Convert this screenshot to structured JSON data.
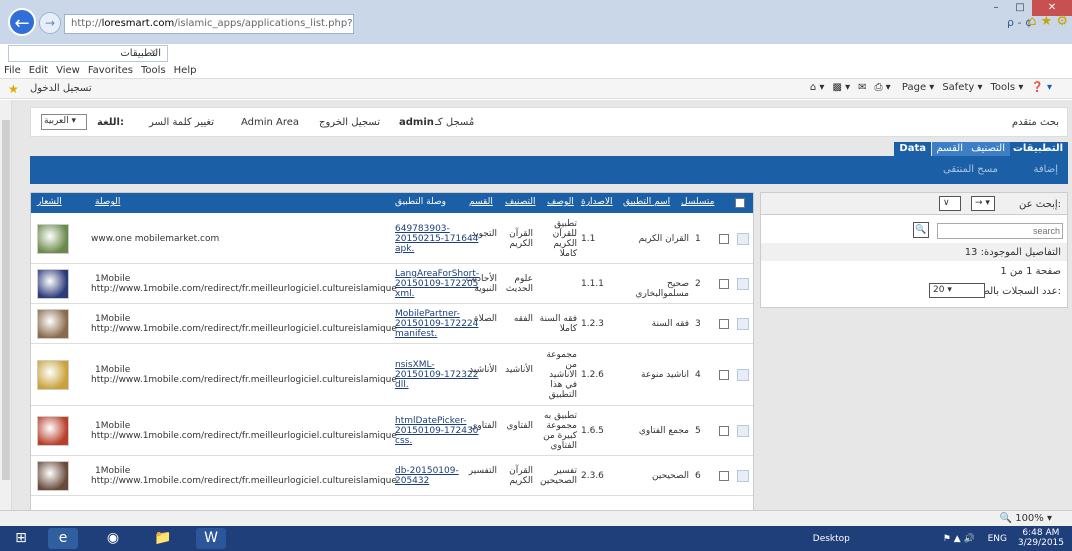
{
  "browser": {
    "url_prefix": "http://",
    "url_domain": "loresmart.com",
    "url_path": "/islamic_apps/applications_list.php?a=return",
    "tab_title": "التطبيقات",
    "tab_close": "×",
    "search_glyph": "ρ - ¢",
    "menu": [
      "File",
      "Edit",
      "View",
      "Favorites",
      "Tools",
      "Help"
    ],
    "fav_link": "تسجيل الدخول",
    "tools": [
      "Page ▾",
      "Safety ▾",
      "Tools ▾"
    ],
    "zoom": "100%"
  },
  "topbar": {
    "advanced_search": "بحث متقدم",
    "logged_as_prefix": "مُسجل كـ",
    "user": "admin",
    "logout": "تسجيل الخروج",
    "admin_area": "Admin Area",
    "change_password": "تغيير كلمة السر",
    "language_label": "اللغة:",
    "language_value": "العربية"
  },
  "tabs": [
    "التطبيقات",
    "التصنيف",
    "القسم",
    "Data"
  ],
  "subbar": {
    "add": "إضافة",
    "delete": "مسح المنتقى"
  },
  "side": {
    "search_for": "إبحث عن:",
    "search_placeholder": "search",
    "found_label": "التفاصيل الموجودة:",
    "found_count": "13",
    "page_info": "صفحة 1 من 1",
    "per_page_label": "عدد السجلات بالصفحة:",
    "per_page_value": "20"
  },
  "table": {
    "headers": {
      "serial": "متسلسل",
      "name": "اسم التطبيق",
      "version": "الاصدارة",
      "desc": "الوصف",
      "category": "التصنيف",
      "section": "القسم",
      "app_link": "وصلة التطبيق",
      "link": "الوصلة",
      "logo": "الشعار"
    },
    "rows": [
      {
        "n": "1",
        "name": "القران الكريم",
        "ver": "1.1",
        "desc": [
          "تطبيق",
          "للقرآن",
          "الكريم",
          "كاملا"
        ],
        "cat": "القرآن الكريم",
        "sec": "التجويد",
        "app": [
          "649783903-",
          "20150215-171644",
          "apk."
        ],
        "link": [
          "www.one mobilemarket.com"
        ]
      },
      {
        "n": "2",
        "name": "صحيح مسلموالبخاري",
        "ver": "1.1.1",
        "desc": [],
        "cat": "علوم الحديث",
        "sec": "الأحاديث النبوية",
        "app": [
          "LangAreaForShort-",
          "20150109-172205",
          "xml."
        ],
        "link": [
          "1Mobile",
          "http://www.1mobile.com/redirect/fr.meilleurlogiciel.cultureislamique"
        ]
      },
      {
        "n": "3",
        "name": "فقه السنة",
        "ver": "1.2.3",
        "desc": [
          "فقه السنة",
          "كاملا"
        ],
        "cat": "الفقه",
        "sec": "الصلاة",
        "app": [
          "MobilePartner-",
          "20150109-172224",
          "manifest."
        ],
        "link": [
          "1Mobile",
          "http://www.1mobile.com/redirect/fr.meilleurlogiciel.cultureislamique"
        ]
      },
      {
        "n": "4",
        "name": "اناشيد منوعة",
        "ver": "1.2.6",
        "desc": [
          "مجموعة",
          "من",
          "الاناشيد",
          "في هذا",
          "التطبيق"
        ],
        "cat": "الأناشيد",
        "sec": "الأناشيد",
        "app": [
          "nsisXML-",
          "20150109-172322",
          "dll."
        ],
        "link": [
          "1Mobile",
          "http://www.1mobile.com/redirect/fr.meilleurlogiciel.cultureislamique"
        ]
      },
      {
        "n": "5",
        "name": "مجمع الفتاوي",
        "ver": "1.6.5",
        "desc": [
          "تطبيق به",
          "مجموعة",
          "كبيرة من",
          "الفتاوي"
        ],
        "cat": "الفتاوي",
        "sec": "الفتاوي",
        "app": [
          "htmlDatePicker-",
          "20150109-172430",
          "css."
        ],
        "link": [
          "1Mobile",
          "http://www.1mobile.com/redirect/fr.meilleurlogiciel.cultureislamique"
        ]
      },
      {
        "n": "6",
        "name": "الصحيحين",
        "ver": "2.3.6",
        "desc": [
          "تفسير",
          "الصحيحين"
        ],
        "cat": "القرآن الكريم",
        "sec": "التفسير",
        "app": [
          "db-20150109-",
          "205432"
        ],
        "link": [
          "1Mobile",
          "http://www.1mobile.com/redirect/fr.meilleurlogiciel.cultureislamique"
        ]
      }
    ]
  },
  "taskbar": {
    "desktop": "Desktop",
    "lang": "ENG",
    "time": "6:48 AM",
    "date": "3/29/2015"
  },
  "colors": {
    "accent": "#1b5fa6",
    "tab_active": "#1b5fa6"
  }
}
